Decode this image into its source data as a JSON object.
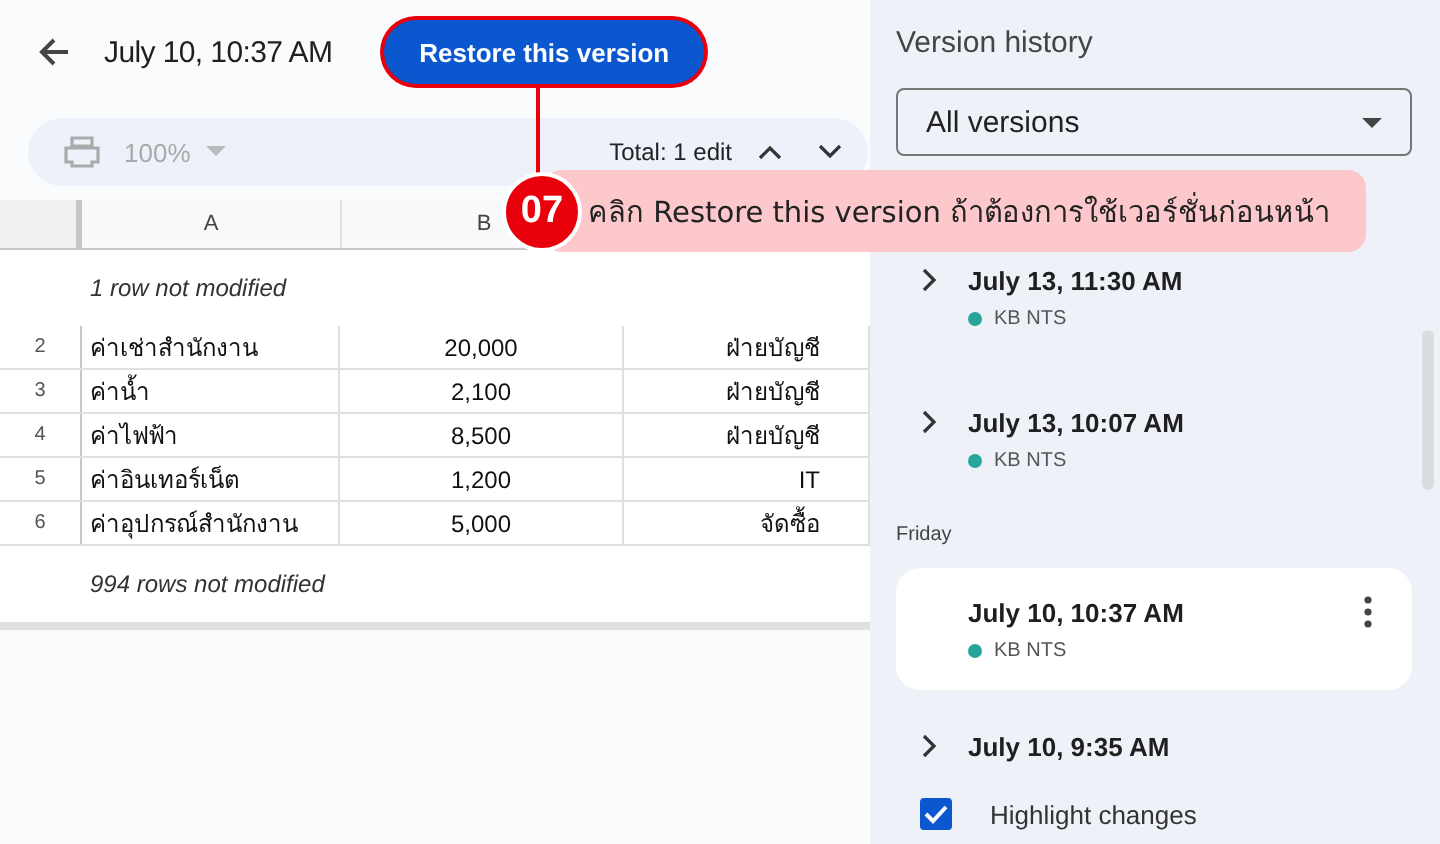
{
  "header": {
    "title": "July 10, 10:37 AM",
    "restore_button": "Restore this version"
  },
  "toolbar": {
    "zoom": "100%",
    "total": "Total: 1 edit"
  },
  "sheet": {
    "columns": [
      "A",
      "B"
    ],
    "rows": [
      {
        "kind": "collapsed",
        "text": "1 row not modified"
      },
      {
        "kind": "row",
        "number": "2",
        "cells": [
          "ค่าเช่าสำนักงาน",
          "20,000",
          "ฝ่ายบัญชี"
        ]
      },
      {
        "kind": "row",
        "number": "3",
        "cells": [
          "ค่าน้ำ",
          "2,100",
          "ฝ่ายบัญชี"
        ]
      },
      {
        "kind": "row",
        "number": "4",
        "cells": [
          "ค่าไฟฟ้า",
          "8,500",
          "ฝ่ายบัญชี"
        ]
      },
      {
        "kind": "row",
        "number": "5",
        "cells": [
          "ค่าอินเทอร์เน็ต",
          "1,200",
          "IT"
        ]
      },
      {
        "kind": "row",
        "number": "6",
        "cells": [
          "ค่าอุปกรณ์สำนักงาน",
          "5,000",
          "จัดซื้อ"
        ]
      },
      {
        "kind": "collapsed",
        "text": "994 rows not modified"
      }
    ]
  },
  "callout": {
    "number": "07",
    "text": "คลิก Restore this version ถ้าต้องการใช้เวอร์ชั่นก่อนหน้า"
  },
  "panel": {
    "title": "Version history",
    "filter": "All versions",
    "entries": [
      {
        "kind": "version",
        "time": "July 13, 11:30 AM",
        "author": "KB NTS",
        "color": "#26a69a",
        "selected": false
      },
      {
        "kind": "version",
        "time": "July 13, 10:07 AM",
        "author": "KB NTS",
        "color": "#26a69a",
        "selected": false
      },
      {
        "kind": "group",
        "label": "Friday"
      },
      {
        "kind": "version",
        "time": "July 10, 10:37 AM",
        "author": "KB NTS",
        "color": "#26a69a",
        "selected": true
      },
      {
        "kind": "version",
        "time": "July 10, 9:35 AM",
        "selected": false
      }
    ],
    "highlight": {
      "label": "Highlight changes",
      "checked": true
    }
  }
}
